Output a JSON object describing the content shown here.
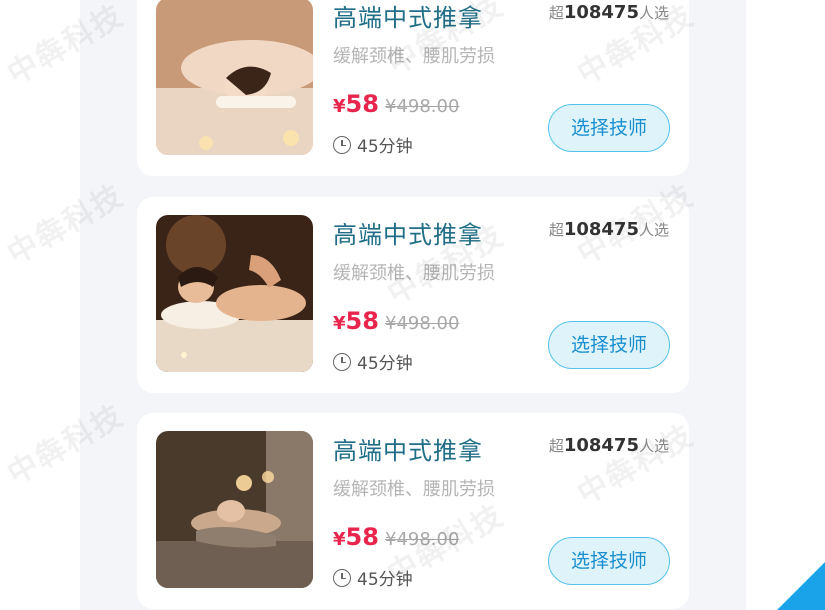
{
  "products": [
    {
      "title": "高端中式推拿",
      "sold_prefix": "超",
      "sold_count": "108475",
      "sold_suffix": "人选",
      "desc": "缓解颈椎、腰肌劳损",
      "currency": "¥",
      "price": "58",
      "original_price": "¥498.00",
      "duration": "45分钟",
      "button": "选择技师",
      "photo": "massage-photo-1"
    },
    {
      "title": "高端中式推拿",
      "sold_prefix": "超",
      "sold_count": "108475",
      "sold_suffix": "人选",
      "desc": "缓解颈椎、腰肌劳损",
      "currency": "¥",
      "price": "58",
      "original_price": "¥498.00",
      "duration": "45分钟",
      "button": "选择技师",
      "photo": "massage-photo-2"
    },
    {
      "title": "高端中式推拿",
      "sold_prefix": "超",
      "sold_count": "108475",
      "sold_suffix": "人选",
      "desc": "缓解颈椎、腰肌劳损",
      "currency": "¥",
      "price": "58",
      "original_price": "¥498.00",
      "duration": "45分钟",
      "button": "选择技师",
      "photo": "massage-photo-3"
    }
  ],
  "watermark": "中犇科技",
  "colors": {
    "title": "#1f6d86",
    "price": "#e8254d",
    "button_border": "#55c2ea",
    "button_bg": "#dff3fb",
    "accent_corner": "#1aa3e8"
  }
}
